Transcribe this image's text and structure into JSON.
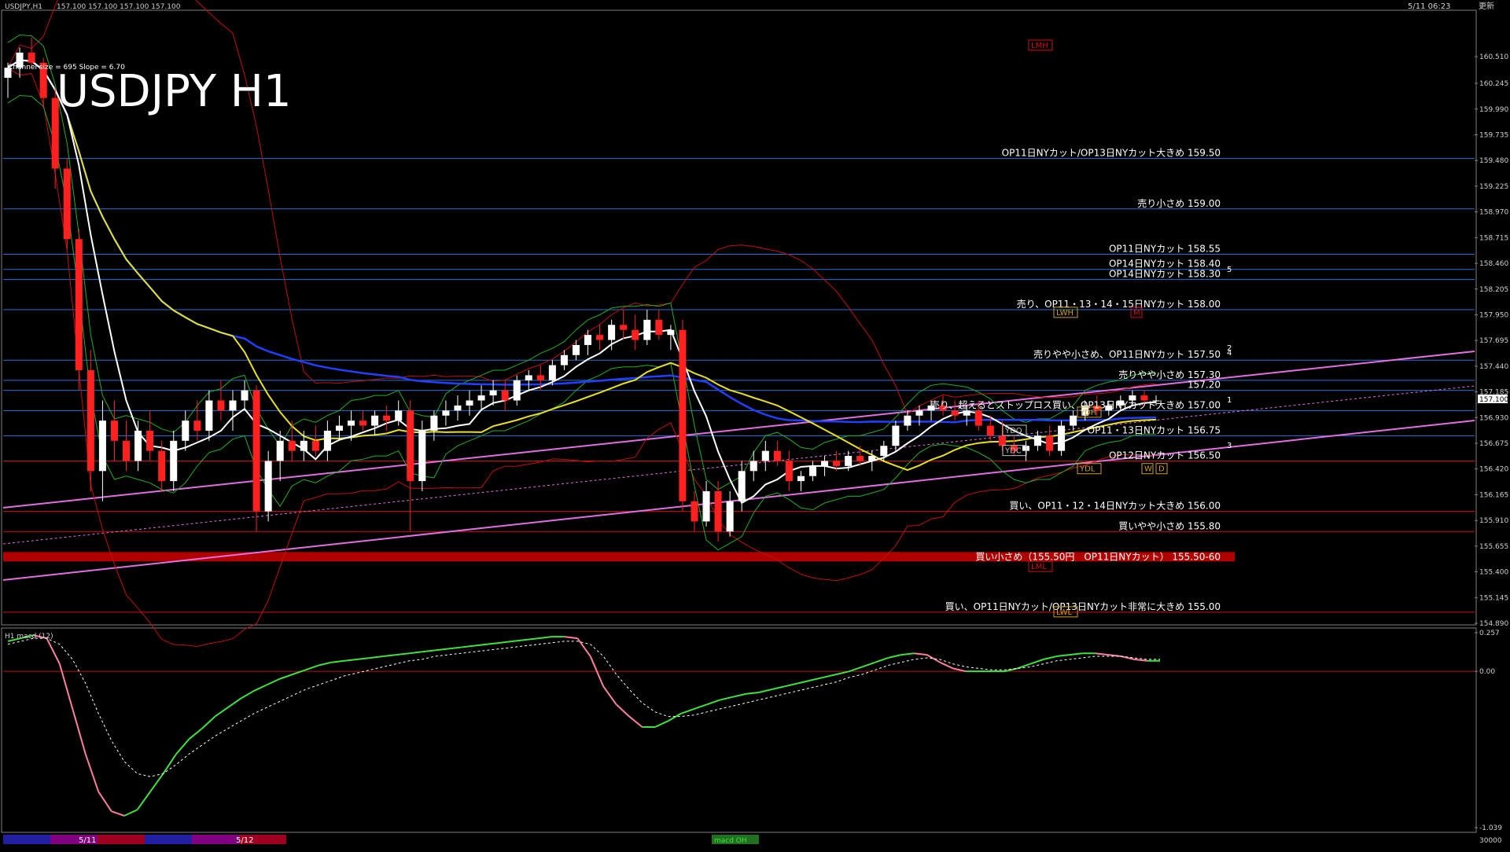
{
  "window": {
    "title": "USDJPY,H1",
    "ohlc_text": "157.100 157.100 157.100 157.100",
    "datetime": "5/11 06:23",
    "time_suffix": "更新",
    "symbol_label": "USDJPY H1",
    "channel_text": "Channel size = 695 Slope = 6.70"
  },
  "colors": {
    "background": "#000000",
    "bull": "#ffffff",
    "bear": "#ff2020",
    "level_blue": "#2a6fd6",
    "level_red": "#d01010",
    "ma_white": "#ffffff",
    "ma_yellow": "#e8e020",
    "ma_blue": "#2040ff",
    "band_red": "#c01010",
    "band_green": "#20b020",
    "channel_pink": "#e070e0",
    "cloud_red": "#ff6a2a",
    "cloud_blue": "#4060ff",
    "macd_green": "#40e040",
    "macd_pink": "#ff7fa0"
  },
  "chart_data": [
    {
      "type": "candlestick",
      "title": "USDJPY H1",
      "ylim": [
        154.89,
        160.76
      ],
      "y_ticks": [
        "160.510",
        "160.245",
        "159.990",
        "159.735",
        "159.480",
        "159.225",
        "158.970",
        "158.715",
        "158.460",
        "158.205",
        "157.950",
        "157.695",
        "157.440",
        "157.185",
        "156.930",
        "156.675",
        "156.420",
        "156.165",
        "155.910",
        "155.655",
        "155.400",
        "155.145",
        "154.890"
      ],
      "last_price": "157.100",
      "candles": [
        [
          160.3,
          160.45,
          160.1,
          160.4
        ],
        [
          160.4,
          160.6,
          160.3,
          160.55
        ],
        [
          160.55,
          160.7,
          160.4,
          160.45
        ],
        [
          160.45,
          160.5,
          160.0,
          160.1
        ],
        [
          160.1,
          160.2,
          159.2,
          159.4
        ],
        [
          159.4,
          159.5,
          158.6,
          158.7
        ],
        [
          158.7,
          158.8,
          157.2,
          157.4
        ],
        [
          157.4,
          157.6,
          156.2,
          156.4
        ],
        [
          156.4,
          157.1,
          156.1,
          156.9
        ],
        [
          156.9,
          157.1,
          156.5,
          156.7
        ],
        [
          156.7,
          156.9,
          156.4,
          156.5
        ],
        [
          156.5,
          156.9,
          156.4,
          156.8
        ],
        [
          156.8,
          157.0,
          156.5,
          156.6
        ],
        [
          156.6,
          156.7,
          156.2,
          156.3
        ],
        [
          156.3,
          156.8,
          156.2,
          156.7
        ],
        [
          156.7,
          157.0,
          156.6,
          156.9
        ],
        [
          156.9,
          157.1,
          156.7,
          156.8
        ],
        [
          156.8,
          157.2,
          156.7,
          157.1
        ],
        [
          157.1,
          157.3,
          156.9,
          157.0
        ],
        [
          157.0,
          157.2,
          156.8,
          157.1
        ],
        [
          157.1,
          157.3,
          157.0,
          157.2
        ],
        [
          157.2,
          157.25,
          155.8,
          156.0
        ],
        [
          156.0,
          156.6,
          155.9,
          156.5
        ],
        [
          156.5,
          156.8,
          156.3,
          156.7
        ],
        [
          156.7,
          156.9,
          156.5,
          156.6
        ],
        [
          156.6,
          156.8,
          156.5,
          156.7
        ],
        [
          156.7,
          156.85,
          156.55,
          156.6
        ],
        [
          156.6,
          156.9,
          156.5,
          156.8
        ],
        [
          156.8,
          156.95,
          156.7,
          156.85
        ],
        [
          156.85,
          157.0,
          156.7,
          156.9
        ],
        [
          156.9,
          157.0,
          156.8,
          156.85
        ],
        [
          156.85,
          157.0,
          156.75,
          156.95
        ],
        [
          156.95,
          157.05,
          156.8,
          156.9
        ],
        [
          156.9,
          157.1,
          156.85,
          157.0
        ],
        [
          157.0,
          157.1,
          155.8,
          156.3
        ],
        [
          156.3,
          156.9,
          156.2,
          156.8
        ],
        [
          156.8,
          157.0,
          156.7,
          156.95
        ],
        [
          156.95,
          157.1,
          156.85,
          157.0
        ],
        [
          157.0,
          157.15,
          156.9,
          157.05
        ],
        [
          157.05,
          157.2,
          156.95,
          157.1
        ],
        [
          157.1,
          157.25,
          157.0,
          157.15
        ],
        [
          157.15,
          157.3,
          157.05,
          157.2
        ],
        [
          157.2,
          157.3,
          157.0,
          157.1
        ],
        [
          157.1,
          157.35,
          157.05,
          157.3
        ],
        [
          157.3,
          157.4,
          157.2,
          157.35
        ],
        [
          157.35,
          157.45,
          157.2,
          157.3
        ],
        [
          157.3,
          157.5,
          157.25,
          157.45
        ],
        [
          157.45,
          157.6,
          157.4,
          157.55
        ],
        [
          157.55,
          157.7,
          157.5,
          157.65
        ],
        [
          157.65,
          157.8,
          157.55,
          157.75
        ],
        [
          157.75,
          157.85,
          157.6,
          157.7
        ],
        [
          157.7,
          157.9,
          157.6,
          157.85
        ],
        [
          157.85,
          158.0,
          157.7,
          157.8
        ],
        [
          157.8,
          157.95,
          157.6,
          157.7
        ],
        [
          157.7,
          158.0,
          157.65,
          157.9
        ],
        [
          157.9,
          158.0,
          157.7,
          157.75
        ],
        [
          157.75,
          157.85,
          157.6,
          157.8
        ],
        [
          157.8,
          157.9,
          156.0,
          156.1
        ],
        [
          156.1,
          156.2,
          155.8,
          155.9
        ],
        [
          155.9,
          156.3,
          155.85,
          156.2
        ],
        [
          156.2,
          156.3,
          155.7,
          155.8
        ],
        [
          155.8,
          156.2,
          155.75,
          156.1
        ],
        [
          156.1,
          156.5,
          156.0,
          156.4
        ],
        [
          156.4,
          156.6,
          156.3,
          156.5
        ],
        [
          156.5,
          156.7,
          156.4,
          156.6
        ],
        [
          156.6,
          156.7,
          156.45,
          156.5
        ],
        [
          156.5,
          156.6,
          156.2,
          156.3
        ],
        [
          156.3,
          156.4,
          156.2,
          156.35
        ],
        [
          156.35,
          156.5,
          156.3,
          156.45
        ],
        [
          156.45,
          156.55,
          156.35,
          156.5
        ],
        [
          156.5,
          156.6,
          156.4,
          156.45
        ],
        [
          156.45,
          156.6,
          156.4,
          156.55
        ],
        [
          156.55,
          156.65,
          156.45,
          156.5
        ],
        [
          156.5,
          156.6,
          156.4,
          156.55
        ],
        [
          156.55,
          156.7,
          156.5,
          156.65
        ],
        [
          156.65,
          156.9,
          156.6,
          156.85
        ],
        [
          156.85,
          157.0,
          156.8,
          156.95
        ],
        [
          156.95,
          157.05,
          156.85,
          157.0
        ],
        [
          157.0,
          157.1,
          156.9,
          157.05
        ],
        [
          157.05,
          157.15,
          156.95,
          157.0
        ],
        [
          157.0,
          157.1,
          156.9,
          156.95
        ],
        [
          156.95,
          157.05,
          156.85,
          157.0
        ],
        [
          157.0,
          157.1,
          156.8,
          156.85
        ],
        [
          156.85,
          156.95,
          156.7,
          156.75
        ],
        [
          156.75,
          156.9,
          156.6,
          156.65
        ],
        [
          156.65,
          156.75,
          156.55,
          156.6
        ],
        [
          156.6,
          156.7,
          156.5,
          156.65
        ],
        [
          156.65,
          156.8,
          156.6,
          156.75
        ],
        [
          156.75,
          156.85,
          156.55,
          156.6
        ],
        [
          156.6,
          156.9,
          156.55,
          156.85
        ],
        [
          156.85,
          157.0,
          156.8,
          156.95
        ],
        [
          156.95,
          157.1,
          156.9,
          157.05
        ],
        [
          157.05,
          157.15,
          156.95,
          157.0
        ],
        [
          157.0,
          157.1,
          156.95,
          157.05
        ],
        [
          157.05,
          157.15,
          157.0,
          157.1
        ],
        [
          157.1,
          157.2,
          157.05,
          157.15
        ],
        [
          157.15,
          157.2,
          157.05,
          157.1
        ],
        [
          157.1,
          157.15,
          157.05,
          157.1
        ]
      ],
      "levels": [
        {
          "price": 159.5,
          "label": "OP11日NYカット/OP13日NYカット大きめ 159.50",
          "color": "#2a6fd6"
        },
        {
          "price": 159.0,
          "label": "売り小さめ 159.00",
          "color": "#2a6fd6"
        },
        {
          "price": 158.55,
          "label": "OP11日NYカット 158.55",
          "color": "#2a6fd6"
        },
        {
          "price": 158.4,
          "label": "OP14日NYカット 158.40",
          "color": "#2a6fd6"
        },
        {
          "price": 158.3,
          "label": "OP14日NYカット 158.30",
          "color": "#2a6fd6"
        },
        {
          "price": 158.0,
          "label": "売り、OP11・13・14・15日NYカット 158.00",
          "color": "#2a6fd6"
        },
        {
          "price": 157.5,
          "label": "売りやや小さめ、OP11日NYカット 157.50",
          "color": "#2a6fd6"
        },
        {
          "price": 157.3,
          "label": "売りやや小さめ 157.30",
          "color": "#2a6fd6"
        },
        {
          "price": 157.2,
          "label": "157.20",
          "color": "#2a6fd6"
        },
        {
          "price": 157.0,
          "label": "売り、超えるとストップロス買い、OP13日NYカット大きめ 157.00",
          "color": "#2a6fd6"
        },
        {
          "price": 156.75,
          "label": "OP11・13日NYカット 156.75",
          "color": "#2a6fd6"
        },
        {
          "price": 156.5,
          "label": "OP12日NYカット 156.50",
          "color": "#d01010"
        },
        {
          "price": 156.0,
          "label": "買い、OP11・12・14日NYカット大きめ 156.00",
          "color": "#d01010"
        },
        {
          "price": 155.8,
          "label": "買いやや小さめ 155.80",
          "color": "#d01010"
        },
        {
          "price": 155.55,
          "label": "買い小さめ（155.50円　OP11日NYカット） 155.50-60",
          "color": "#b00000",
          "band": true
        },
        {
          "price": 155.0,
          "label": "買い、OP11日NYカット/OP13日NYカット非常に大きめ 155.00",
          "color": "#d01010"
        }
      ],
      "tags": [
        {
          "label": "LMH",
          "price": 160.62,
          "color": "#d01010"
        },
        {
          "label": "LWH",
          "price": 157.97,
          "color": "#d0a020"
        },
        {
          "label": "M",
          "price": 157.97,
          "color": "#d01010"
        },
        {
          "label": "YDH",
          "price": 156.98,
          "color": "#d0a020"
        },
        {
          "label": "YDO",
          "price": 156.8,
          "color": "#c0c0c0"
        },
        {
          "label": "YDC",
          "price": 156.6,
          "color": "#c0c0c0"
        },
        {
          "label": "YDL",
          "price": 156.42,
          "color": "#d0a020"
        },
        {
          "label": "W",
          "price": 156.42,
          "color": "#d0a020"
        },
        {
          "label": "D",
          "price": 156.42,
          "color": "#d0a020"
        },
        {
          "label": "LML",
          "price": 155.45,
          "color": "#d01010"
        },
        {
          "label": "LWL",
          "price": 155.0,
          "color": "#d0a020"
        }
      ],
      "channel_marks": [
        "5",
        "4",
        "2",
        "1",
        "3"
      ]
    },
    {
      "type": "line",
      "title": "H1 macd (12)",
      "ylim": [
        -1.039,
        0.257
      ],
      "y_ticks": [
        "0.257",
        "0.00",
        "-1.039"
      ],
      "series": [
        {
          "values": [
            0.2,
            0.22,
            0.24,
            0.22,
            0.05,
            -0.25,
            -0.55,
            -0.8,
            -0.93,
            -0.96,
            -0.92,
            -0.8,
            -0.68,
            -0.55,
            -0.45,
            -0.38,
            -0.3,
            -0.24,
            -0.18,
            -0.13,
            -0.09,
            -0.05,
            -0.02,
            0.01,
            0.04,
            0.06,
            0.07,
            0.08,
            0.09,
            0.1,
            0.11,
            0.12,
            0.13,
            0.14,
            0.15,
            0.16,
            0.17,
            0.18,
            0.19,
            0.2,
            0.21,
            0.22,
            0.23,
            0.23,
            0.22,
            0.1,
            -0.1,
            -0.22,
            -0.3,
            -0.37,
            -0.37,
            -0.33,
            -0.28,
            -0.25,
            -0.22,
            -0.19,
            -0.17,
            -0.15,
            -0.14,
            -0.12,
            -0.1,
            -0.08,
            -0.06,
            -0.04,
            -0.02,
            0.0,
            0.03,
            0.06,
            0.09,
            0.11,
            0.12,
            0.11,
            0.06,
            0.02,
            0.0,
            0.0,
            0.0,
            0.0,
            0.02,
            0.05,
            0.08,
            0.1,
            0.11,
            0.12,
            0.12,
            0.11,
            0.1,
            0.08,
            0.07,
            0.07
          ]
        },
        {
          "values": [
            0.18,
            0.2,
            0.22,
            0.22,
            0.18,
            0.08,
            -0.08,
            -0.28,
            -0.46,
            -0.6,
            -0.68,
            -0.7,
            -0.68,
            -0.62,
            -0.55,
            -0.49,
            -0.43,
            -0.38,
            -0.33,
            -0.28,
            -0.24,
            -0.2,
            -0.16,
            -0.12,
            -0.09,
            -0.06,
            -0.03,
            -0.01,
            0.01,
            0.03,
            0.05,
            0.07,
            0.08,
            0.1,
            0.11,
            0.12,
            0.13,
            0.14,
            0.15,
            0.16,
            0.17,
            0.18,
            0.19,
            0.2,
            0.2,
            0.18,
            0.1,
            -0.02,
            -0.12,
            -0.21,
            -0.27,
            -0.3,
            -0.3,
            -0.29,
            -0.27,
            -0.25,
            -0.23,
            -0.21,
            -0.19,
            -0.17,
            -0.15,
            -0.13,
            -0.11,
            -0.09,
            -0.07,
            -0.04,
            -0.02,
            0.01,
            0.04,
            0.06,
            0.08,
            0.09,
            0.08,
            0.05,
            0.03,
            0.02,
            0.01,
            0.01,
            0.02,
            0.03,
            0.05,
            0.07,
            0.08,
            0.09,
            0.1,
            0.1,
            0.1,
            0.09,
            0.08,
            0.08
          ]
        }
      ]
    }
  ],
  "timebar": {
    "labels": [
      "5/11",
      "5/12"
    ],
    "colors": [
      "#2020a0",
      "#800080",
      "#a00020",
      "#2020a0",
      "#800080",
      "#a00020"
    ],
    "right_label": "macd OH",
    "corner_value": "30000"
  }
}
